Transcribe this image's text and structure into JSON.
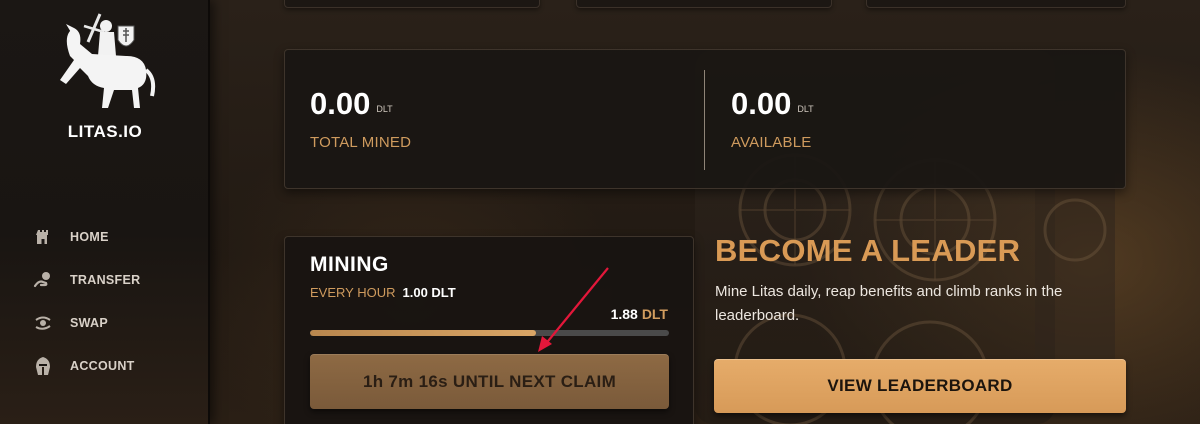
{
  "app": {
    "logo_text": "LITAS.IO",
    "colors": {
      "accent": "#d99a55",
      "label": "#cf9b5e",
      "button_primary": "#e0a462",
      "button_disabled": "#86643f",
      "annotation": "#e3173a"
    }
  },
  "sidebar": {
    "items": [
      {
        "label": "HOME",
        "icon": "castle-tower-icon"
      },
      {
        "label": "TRANSFER",
        "icon": "transfer-hand-icon"
      },
      {
        "label": "SWAP",
        "icon": "swap-hand-icon"
      },
      {
        "label": "ACCOUNT",
        "icon": "helmet-icon"
      }
    ]
  },
  "stats": {
    "total_mined": {
      "value": "0.00",
      "unit": "DLT",
      "label": "TOTAL MINED"
    },
    "available": {
      "value": "0.00",
      "unit": "DLT",
      "label": "AVAILABLE"
    }
  },
  "mining": {
    "title": "MINING",
    "rate_label": "EVERY HOUR",
    "rate_value": "1.00 DLT",
    "mined_value": "1.88",
    "mined_unit": "DLT",
    "progress_fraction": 0.63,
    "claim_button": "1h 7m 16s UNTIL NEXT CLAIM"
  },
  "leader": {
    "title": "BECOME A LEADER",
    "description": "Mine Litas daily, reap benefits and climb ranks in the leaderboard.",
    "button": "VIEW LEADERBOARD"
  }
}
